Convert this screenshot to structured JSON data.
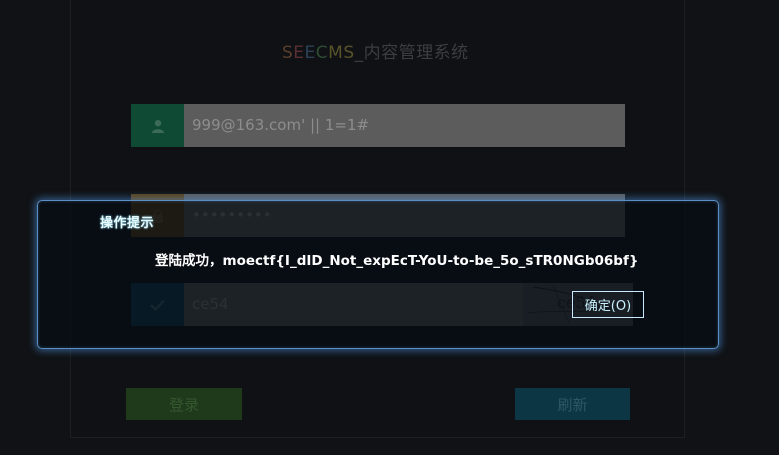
{
  "logo": {
    "part1": "S",
    "part2": "E",
    "part3": "E",
    "part4": "C",
    "part5": "MS",
    "suffix": "_内容管理系统"
  },
  "form": {
    "username_value": "999@163.com' || 1=1#",
    "password_value": "•••••••••",
    "captcha_value": "ce54",
    "captcha_image_text": "ce54"
  },
  "buttons": {
    "login": "登录",
    "refresh": "刷新"
  },
  "dialog": {
    "title": "操作提示",
    "message": "登陆成功，moectf{I_dID_Not_expEcT-YoU-to-be_5o_sTR0NGb06bf}",
    "ok_label": "确定(O)"
  },
  "icons": {
    "user": "user-icon",
    "lock": "lock-icon",
    "check": "check-icon"
  }
}
